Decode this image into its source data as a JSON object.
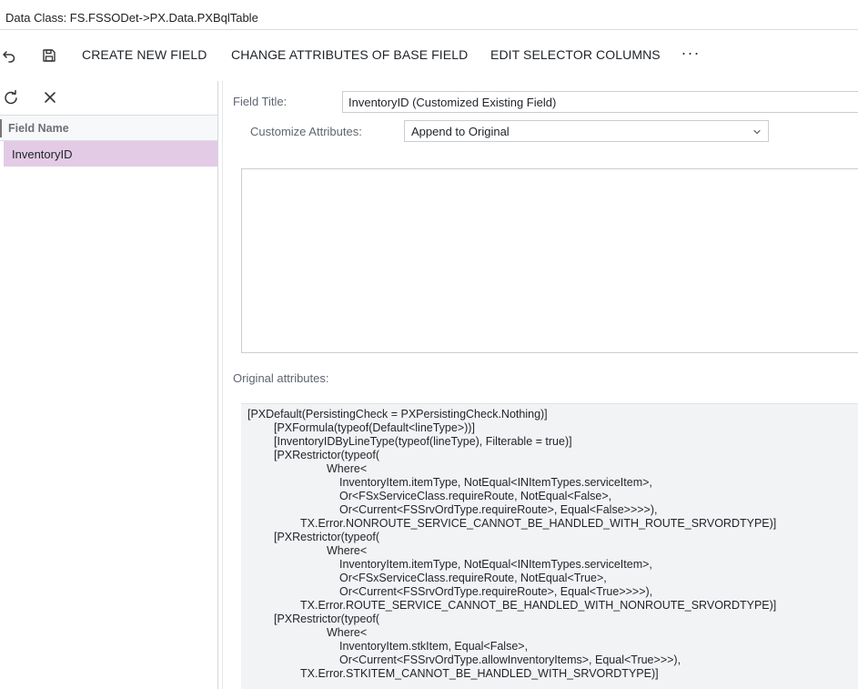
{
  "header": {
    "title": "Data Class: FS.FSSODet->PX.Data.PXBqlTable"
  },
  "toolbar": {
    "icons": [
      "undo-icon",
      "save-icon"
    ],
    "create_new_field": "CREATE NEW FIELD",
    "change_attributes": "CHANGE ATTRIBUTES OF BASE FIELD",
    "edit_selector_columns": "EDIT SELECTOR COLUMNS",
    "more": "···"
  },
  "left_panel": {
    "icons": [
      "refresh-icon",
      "close-icon"
    ],
    "column_header": "Field Name",
    "rows": [
      {
        "field_name": "InventoryID"
      }
    ]
  },
  "form": {
    "field_title_label": "Field Title:",
    "field_title_value": "InventoryID (Customized Existing Field)",
    "customize_attributes_label": "Customize Attributes:",
    "customize_attributes_value": "Append to Original",
    "custom_attributes_text": "",
    "original_attributes_label": "Original attributes:",
    "original_attributes_lines": [
      "[PXDefault(PersistingCheck = PXPersistingCheck.Nothing)]",
      "[PXFormula(typeof(Default<lineType>))]",
      "[InventoryIDByLineType(typeof(lineType), Filterable = true)]",
      "[PXRestrictor(typeof(",
      "Where<",
      "InventoryItem.itemType, NotEqual<INItemTypes.serviceItem>,",
      "Or<FSxServiceClass.requireRoute, NotEqual<False>,",
      "Or<Current<FSSrvOrdType.requireRoute>, Equal<False>>>>),",
      "TX.Error.NONROUTE_SERVICE_CANNOT_BE_HANDLED_WITH_ROUTE_SRVORDTYPE)]",
      "[PXRestrictor(typeof(",
      "Where<",
      "InventoryItem.itemType, NotEqual<INItemTypes.serviceItem>,",
      "Or<FSxServiceClass.requireRoute, NotEqual<True>,",
      "Or<Current<FSSrvOrdType.requireRoute>, Equal<True>>>>),",
      "TX.Error.ROUTE_SERVICE_CANNOT_BE_HANDLED_WITH_NONROUTE_SRVORDTYPE)]",
      "[PXRestrictor(typeof(",
      "Where<",
      "InventoryItem.stkItem, Equal<False>,",
      "Or<Current<FSSrvOrdType.allowInventoryItems>, Equal<True>>>),",
      "TX.Error.STKITEM_CANNOT_BE_HANDLED_WITH_SRVORDTYPE)]"
    ]
  }
}
